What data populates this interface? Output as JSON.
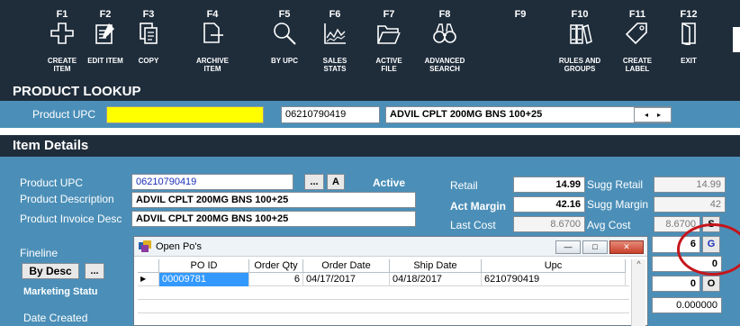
{
  "toolbar": {
    "keys": [
      {
        "key": "F1",
        "label": "CREATE\nITEM",
        "icon": "plus-icon"
      },
      {
        "key": "F2",
        "label": "EDIT ITEM",
        "icon": "edit-icon"
      },
      {
        "key": "F3",
        "label": "COPY",
        "icon": "copy-icon"
      },
      {
        "key": "F4",
        "label": "ARCHIVE\nITEM",
        "icon": "archive-icon"
      },
      {
        "key": "F5",
        "label": "BY UPC",
        "icon": "magnifier-icon"
      },
      {
        "key": "F6",
        "label": "SALES\nSTATS",
        "icon": "chart-icon"
      },
      {
        "key": "F7",
        "label": "ACTIVE\nFILE",
        "icon": "folder-icon"
      },
      {
        "key": "F8",
        "label": "ADVANCED\nSEARCH",
        "icon": "binoculars-icon"
      },
      {
        "key": "F9",
        "label": "",
        "icon": ""
      },
      {
        "key": "F10",
        "label": "RULES AND\nGROUPS",
        "icon": "books-icon"
      },
      {
        "key": "F11",
        "label": "CREATE\nLABEL",
        "icon": "tag-icon"
      },
      {
        "key": "F12",
        "label": "EXIT",
        "icon": "door-icon"
      }
    ]
  },
  "lookup": {
    "title": "PRODUCT LOOKUP",
    "upc_label": "Product UPC",
    "upc_value": "06210790419",
    "desc_value": "ADVIL CPLT 200MG BNS 100+25",
    "nav_prev": "◂",
    "nav_next": "▸"
  },
  "details": {
    "title": "Item Details",
    "upc_label": "Product UPC",
    "upc_value": "06210790419",
    "ellipsis_button": "...",
    "a_button": "A",
    "status": "Active",
    "desc_label": "Product Description",
    "desc_value": "ADVIL CPLT 200MG BNS 100+25",
    "invoice_label": "Product Invoice Desc",
    "invoice_value": "ADVIL CPLT 200MG BNS 100+25",
    "retail_label": "Retail",
    "retail_value": "14.99",
    "sugg_retail_label": "Sugg Retail",
    "sugg_retail_value": "14.99",
    "act_margin_label": "Act Margin",
    "act_margin_value": "42.16",
    "sugg_margin_label": "Sugg Margin",
    "sugg_margin_value": "42",
    "last_cost_label": "Last Cost",
    "last_cost_value": "8.6700",
    "avg_cost_label": "Avg Cost",
    "avg_cost_value": "8.6700",
    "s_button": "S",
    "g_value": "6",
    "g_button": "G",
    "zero_value": "0",
    "o_value": "0",
    "o_button": "O",
    "decimal_value": "0.000000",
    "fineline_label": "Fineline",
    "by_desc_button": "By Desc",
    "fineline_ellipsis": "...",
    "marketing_label": "Marketing Statu",
    "date_created_label": "Date Created"
  },
  "dialog": {
    "title": "Open Po's",
    "minimize": "—",
    "maximize": "□",
    "close": "✕",
    "columns": [
      "PO ID",
      "Order Qty",
      "Order Date",
      "Ship Date",
      "Upc"
    ],
    "rows": [
      [
        "00009781",
        "6",
        "04/17/2017",
        "04/18/2017",
        "6210790419"
      ]
    ]
  },
  "colors": {
    "toolbar_bg": "#1f2d3b",
    "panel_bg": "#4b8fb8",
    "highlight_yellow": "#ffff00",
    "selected_row": "#3399ff",
    "annotation_red": "#c4161c"
  }
}
